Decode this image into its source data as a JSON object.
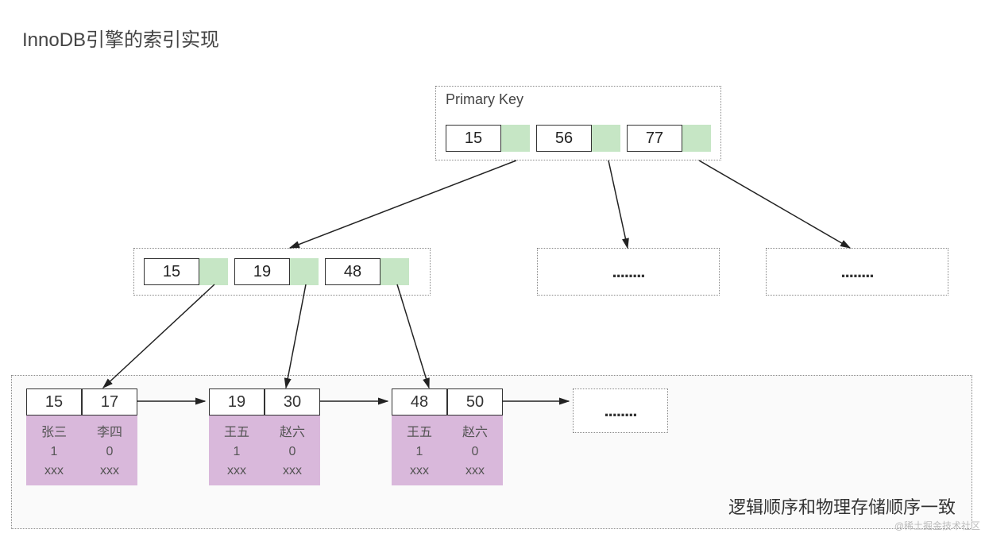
{
  "title": "InnoDB引擎的索引实现",
  "root": {
    "label": "Primary Key",
    "keys": [
      "15",
      "56",
      "77"
    ]
  },
  "internal": {
    "keys": [
      "15",
      "19",
      "48"
    ]
  },
  "ellipsis": "........",
  "leaves": [
    {
      "keys": [
        "15",
        "17"
      ],
      "rows": [
        [
          "张三",
          "1",
          "xxx"
        ],
        [
          "李四",
          "0",
          "xxx"
        ]
      ]
    },
    {
      "keys": [
        "19",
        "30"
      ],
      "rows": [
        [
          "王五",
          "1",
          "xxx"
        ],
        [
          "赵六",
          "0",
          "xxx"
        ]
      ]
    },
    {
      "keys": [
        "48",
        "50"
      ],
      "rows": [
        [
          "王五",
          "1",
          "xxx"
        ],
        [
          "赵六",
          "0",
          "xxx"
        ]
      ]
    }
  ],
  "caption": "逻辑顺序和物理存储顺序一致",
  "watermark": "@稀土掘金技术社区"
}
